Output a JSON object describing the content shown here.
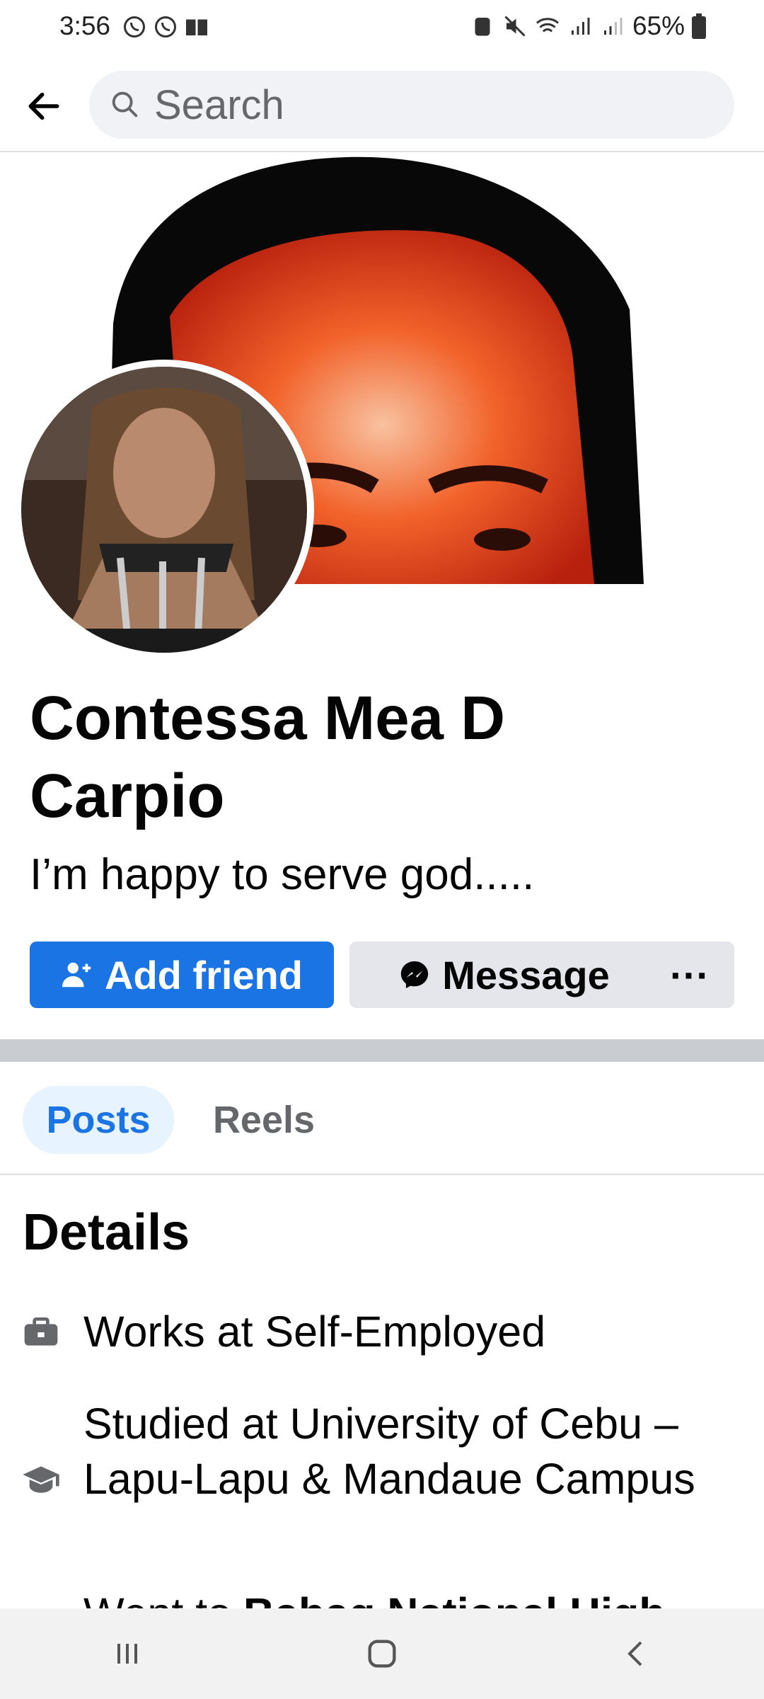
{
  "status_bar": {
    "time": "3:56",
    "battery": "65%"
  },
  "search": {
    "placeholder": "Search"
  },
  "profile": {
    "name": "Contessa Mea D Carpio",
    "bio": "I’m happy to serve god....."
  },
  "actions": {
    "add_friend": "Add friend",
    "message": "Message",
    "more": "···"
  },
  "tabs": [
    {
      "label": "Posts",
      "active": true
    },
    {
      "label": "Reels",
      "active": false
    }
  ],
  "details": {
    "title": "Details",
    "items": [
      {
        "icon": "briefcase-icon",
        "text": "Works at Self-Employed"
      },
      {
        "icon": "graduation-cap-icon",
        "text": "Studied at University of Cebu – Lapu-Lapu & Mandaue Campus"
      },
      {
        "icon": "graduation-cap-icon",
        "text_prefix": "Went to ",
        "text_bold": "Babag National High"
      }
    ]
  },
  "colors": {
    "accent": "#1b74e4",
    "button_gray": "#e4e6eb",
    "tab_active_bg": "#e7f3ff"
  }
}
